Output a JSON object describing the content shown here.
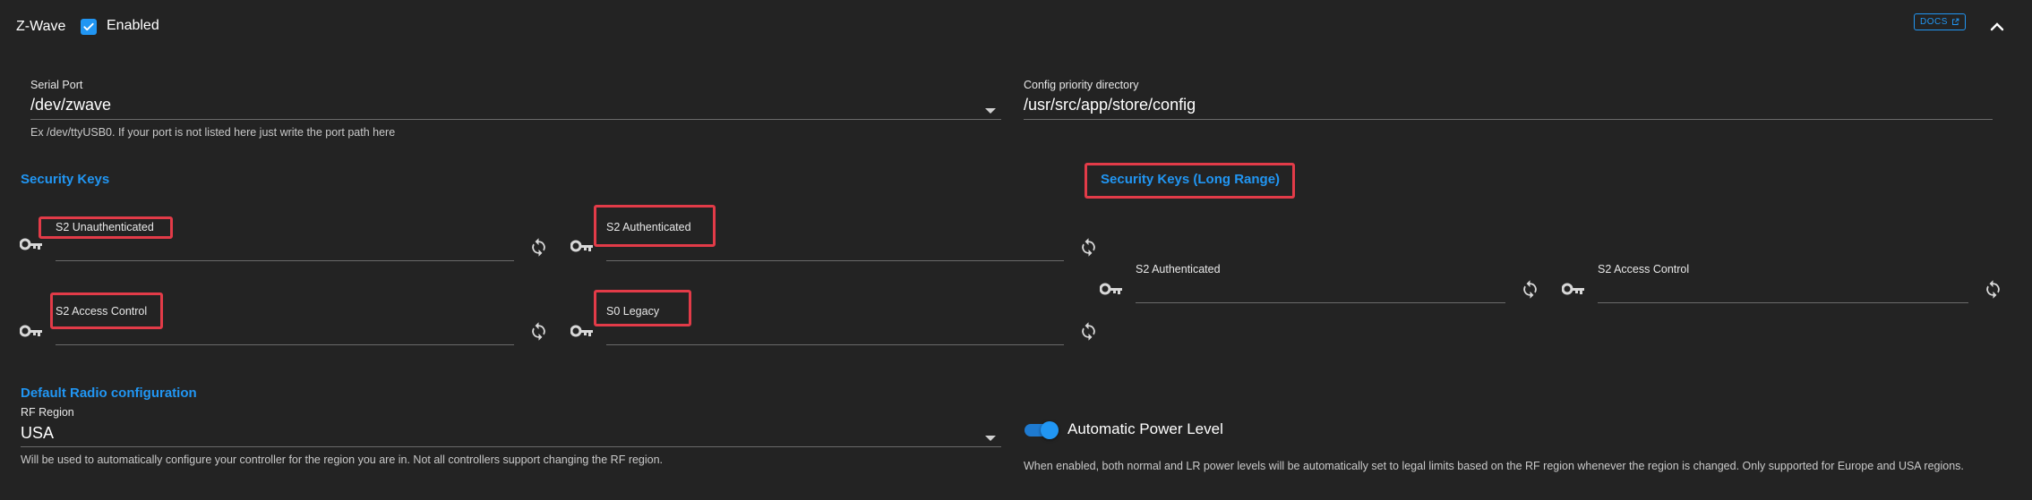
{
  "header": {
    "title": "Z-Wave",
    "enabled_label": "Enabled",
    "enabled": true,
    "docs_label": "DOCS"
  },
  "serial_port": {
    "label": "Serial Port",
    "value": "/dev/zwave",
    "hint": "Ex /dev/ttyUSB0. If your port is not listed here just write the port path here"
  },
  "config_dir": {
    "label": "Config priority directory",
    "value": "/usr/src/app/store/config"
  },
  "security_keys": {
    "title": "Security Keys",
    "keys": [
      {
        "label": "S2 Unauthenticated"
      },
      {
        "label": "S2 Authenticated"
      },
      {
        "label": "S2 Access Control"
      },
      {
        "label": "S0 Legacy"
      }
    ]
  },
  "security_keys_lr": {
    "title": "Security Keys (Long Range)",
    "keys": [
      {
        "label": "S2 Authenticated"
      },
      {
        "label": "S2 Access Control"
      }
    ]
  },
  "radio": {
    "title": "Default Radio configuration",
    "rf_region_label": "RF Region",
    "rf_region_value": "USA",
    "rf_region_hint": "Will be used to automatically configure your controller for the region you are in. Not all controllers support changing the RF region.",
    "auto_power_label": "Automatic Power Level",
    "auto_power_enabled": true,
    "auto_power_hint": "When enabled, both normal and LR power levels will be automatically set to legal limits based on the RF region whenever the region is changed. Only supported for Europe and USA regions."
  },
  "colors": {
    "background": "#232323",
    "accent": "#2196f3",
    "highlight": "#e23b48"
  }
}
